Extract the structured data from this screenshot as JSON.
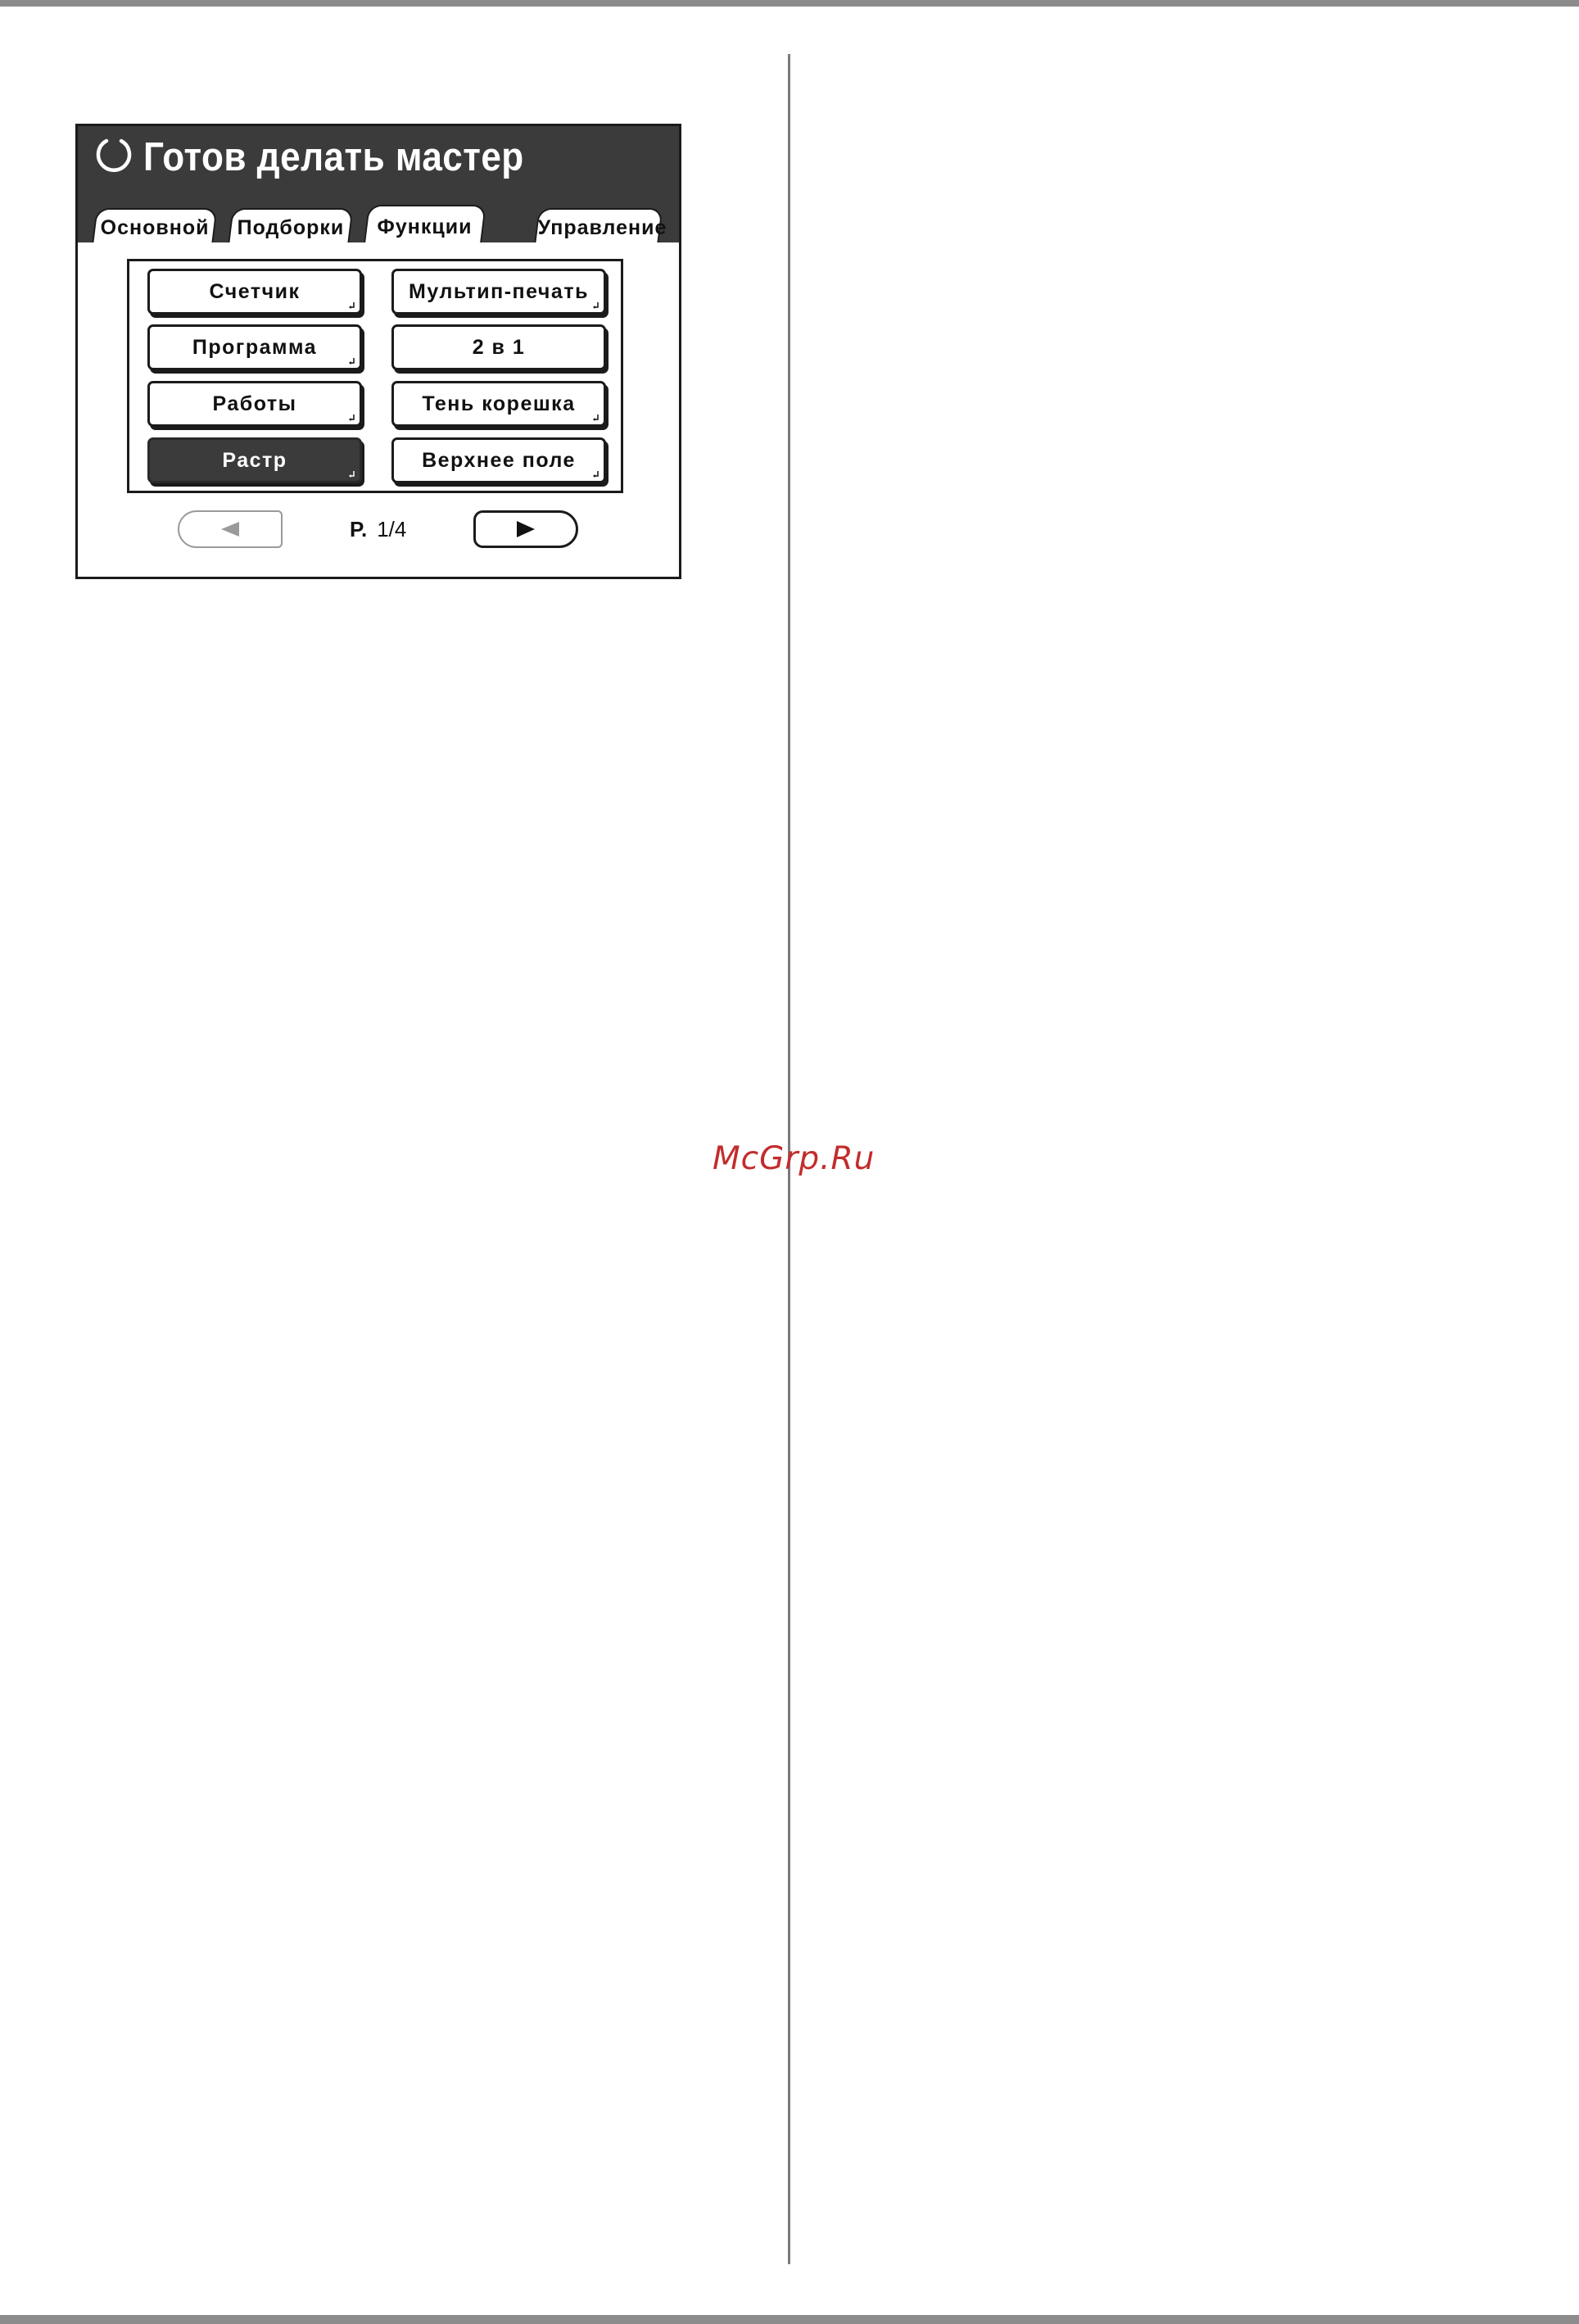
{
  "header": {
    "title": "Готов делать мастер",
    "status_icon": "ready-circle-icon"
  },
  "tabs": [
    {
      "label": "Основной",
      "active": false
    },
    {
      "label": "Подборки",
      "active": false
    },
    {
      "label": "Функции",
      "active": true
    },
    {
      "label": "Управление",
      "active": false
    }
  ],
  "functions": [
    {
      "label": "Счетчик",
      "selected": false
    },
    {
      "label": "Мультип-печать",
      "selected": false
    },
    {
      "label": "Программа",
      "selected": false
    },
    {
      "label": "2 в 1",
      "selected": false
    },
    {
      "label": "Работы",
      "selected": false
    },
    {
      "label": "Тень корешка",
      "selected": false
    },
    {
      "label": "Растр",
      "selected": true
    },
    {
      "label": "Верхнее поле",
      "selected": false
    }
  ],
  "pagination": {
    "prefix": "P.",
    "value": "1/4",
    "prev_icon": "triangle-left-icon",
    "next_icon": "triangle-right-icon",
    "prev_enabled": false
  },
  "watermark": "McGrp.Ru",
  "colors": {
    "header_bg": "#3b3b3b",
    "selected_bg": "#3b3b3b",
    "watermark": "#c32c2c",
    "border": "#1b1b1b"
  }
}
